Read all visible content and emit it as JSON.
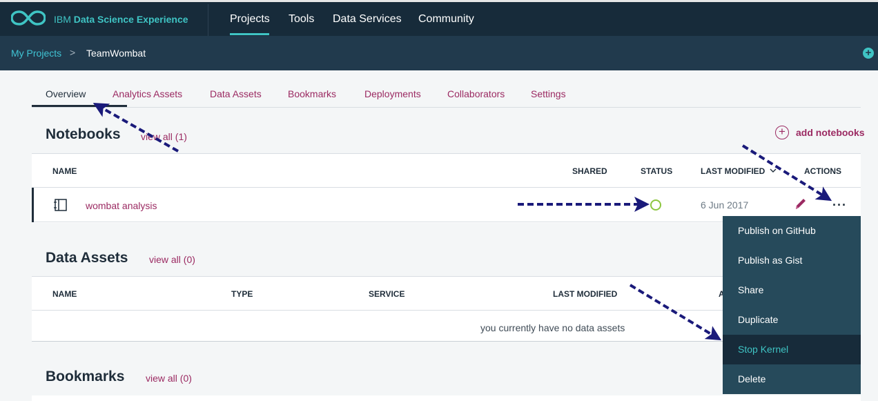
{
  "header": {
    "brand_prefix": "IBM",
    "brand_name": "Data Science Experience",
    "nav": [
      "Projects",
      "Tools",
      "Data Services",
      "Community"
    ],
    "active_nav": "Projects",
    "logo_icon": "infinity-logo-icon"
  },
  "breadcrumb": {
    "parent": "My Projects",
    "current": "TeamWombat",
    "separator": ">"
  },
  "tabs": [
    "Overview",
    "Analytics Assets",
    "Data Assets",
    "Bookmarks",
    "Deployments",
    "Collaborators",
    "Settings"
  ],
  "active_tab": "Overview",
  "notebooks": {
    "title": "Notebooks",
    "view_all": "view all (1)",
    "add_label": "add notebooks",
    "columns": [
      "NAME",
      "SHARED",
      "STATUS",
      "LAST MODIFIED",
      "ACTIONS"
    ],
    "rows": [
      {
        "name": "wombat analysis",
        "shared": "",
        "status": "stopped",
        "last_modified": "6 Jun 2017",
        "actions_label": "..."
      }
    ]
  },
  "data_assets": {
    "title": "Data Assets",
    "view_all": "view all (0)",
    "columns": [
      "NAME",
      "TYPE",
      "SERVICE",
      "LAST MODIFIED",
      "A"
    ],
    "empty_message": "you currently have no data assets"
  },
  "bookmarks": {
    "title": "Bookmarks",
    "view_all": "view all (0)"
  },
  "actions_menu": {
    "items": [
      "Publish on GitHub",
      "Publish as Gist",
      "Share",
      "Duplicate",
      "Stop Kernel",
      "Delete"
    ],
    "highlighted": "Stop Kernel"
  },
  "colors": {
    "topbar": "#172b3a",
    "subbar": "#213a4d",
    "accent_teal": "#3fc4c4",
    "link_magenta": "#9b2a62",
    "status_green": "#8cc63f",
    "menu_bg": "#264a5b",
    "annotation_arrow": "#1a1a7a"
  }
}
